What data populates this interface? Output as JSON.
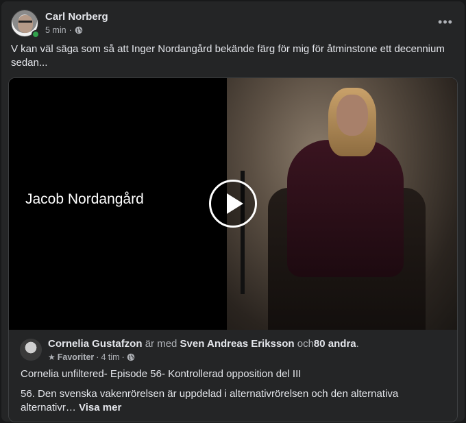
{
  "post": {
    "author": "Carl Norberg",
    "time": "5 min",
    "dot": "·",
    "more": "•••",
    "text": "V kan väl säga som så att Inger Nordangård bekände färg för mig för åtminstone ett decennium sedan..."
  },
  "video": {
    "title": "Jacob Nordangård"
  },
  "shared": {
    "author": "Cornelia Gustafzon",
    "with_text": "är med",
    "tagged": "Sven Andreas Eriksson",
    "and_text": "och",
    "others": "80 andra",
    "period": ".",
    "favorite": "Favoriter",
    "time": "4 tim",
    "dot": "·",
    "title": "Cornelia unfiltered- Episode 56- Kontrollerad opposition del III",
    "description": "56. Den svenska vakenrörelsen är uppdelad i alternativrörelsen och den alternativa alternativr…",
    "see_more": "Visa mer"
  },
  "colors": {
    "background": "#242526",
    "text_primary": "#e4e6eb",
    "text_secondary": "#b0b3b8",
    "online": "#31a24c"
  }
}
